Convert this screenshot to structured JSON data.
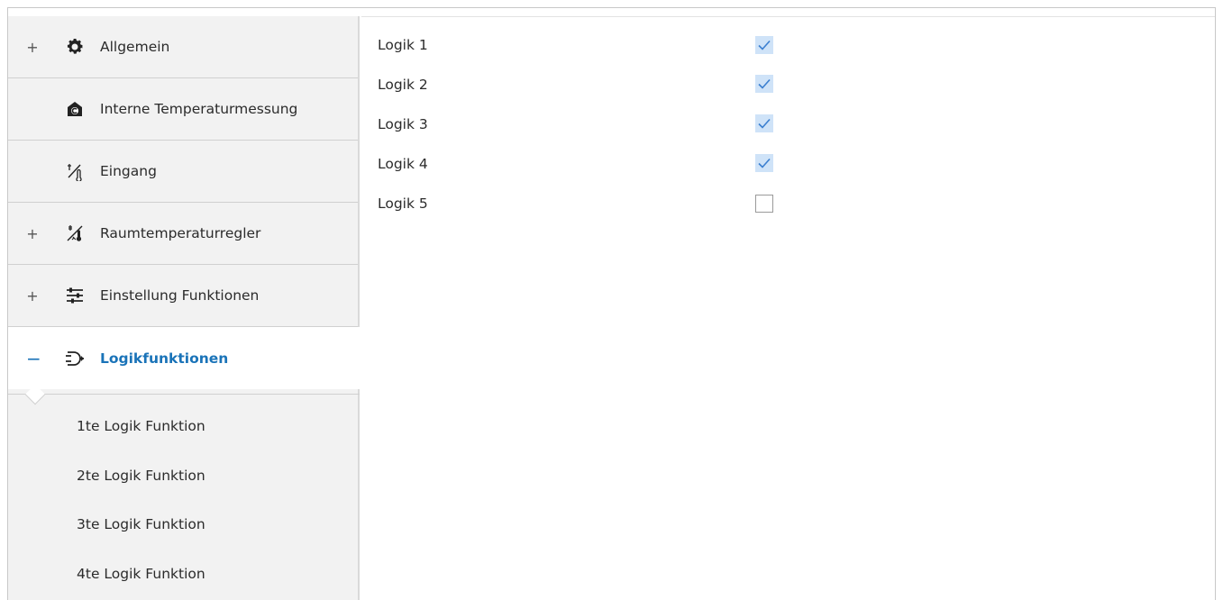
{
  "sidebar": {
    "items": [
      {
        "label": "Allgemein",
        "expander": "+",
        "icon": "gear-icon"
      },
      {
        "label": "Interne Temperaturmessung",
        "expander": "",
        "icon": "house-c-icon"
      },
      {
        "label": "Eingang",
        "expander": "",
        "icon": "input-sensor-icon"
      },
      {
        "label": "Raumtemperaturregler",
        "expander": "+",
        "icon": "thermostat-icon"
      },
      {
        "label": "Einstellung Funktionen",
        "expander": "+",
        "icon": "sliders-icon"
      },
      {
        "label": "Logikfunktionen",
        "expander": "−",
        "icon": "logic-gate-icon"
      }
    ],
    "subitems": [
      "1te Logik Funktion",
      "2te Logik Funktion",
      "3te Logik Funktion",
      "4te Logik Funktion"
    ]
  },
  "main": {
    "logic_rows": [
      {
        "label": "Logik 1",
        "checked": true
      },
      {
        "label": "Logik 2",
        "checked": true
      },
      {
        "label": "Logik 3",
        "checked": true
      },
      {
        "label": "Logik 4",
        "checked": true
      },
      {
        "label": "Logik 5",
        "checked": false
      }
    ]
  },
  "colors": {
    "accent": "#1a73b8",
    "check_fill": "#cfe3f8",
    "check_mark": "#3b7fd0",
    "sidebar_bg": "#f2f2f2"
  }
}
